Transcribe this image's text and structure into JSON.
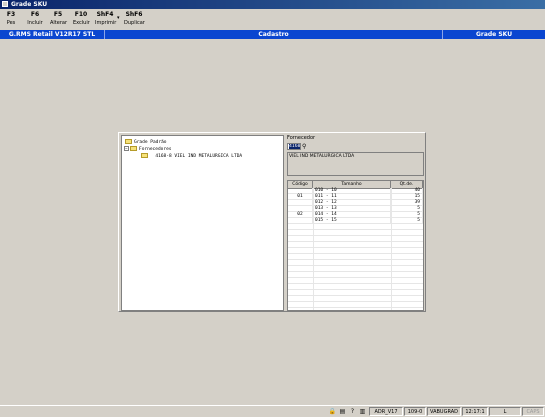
{
  "window": {
    "title": "Grade SKU"
  },
  "toolbar": [
    {
      "key": "F3",
      "label": "Pes"
    },
    {
      "key": "F6",
      "label": "Incluir"
    },
    {
      "key": "F5",
      "label": "Alterar"
    },
    {
      "key": "F10",
      "label": "Excluir"
    },
    {
      "key": "ShF4",
      "label": "Imprimir"
    },
    {
      "key": "ShF6",
      "label": "Duplicar"
    }
  ],
  "toolbar_dropdown": "▾",
  "header": {
    "system": "G.RMS Retail V12R17 STL",
    "section": "Cadastro",
    "module": "Grade SKU",
    "color": "#0a46d0"
  },
  "tree": {
    "root": "Grade Padrão",
    "group": "Fornecedores",
    "group_expander": "−",
    "item": "4168-8 VIEL IND METALURGICA LTDA"
  },
  "fornecedor": {
    "label": "Fornecedor",
    "code": "4168",
    "description": "VIEL IND METALURGICA LTDA"
  },
  "grid": {
    "headers": [
      "Código",
      "Tamanho",
      "Qt.de."
    ],
    "rows": [
      {
        "codigo": "",
        "tamanho": "010 - 10",
        "qtde": "40"
      },
      {
        "codigo": "01",
        "tamanho": "011 - 11",
        "qtde": "15"
      },
      {
        "codigo": "",
        "tamanho": "012 - 12",
        "qtde": "39"
      },
      {
        "codigo": "",
        "tamanho": "013 - 13",
        "qtde": "5"
      },
      {
        "codigo": "02",
        "tamanho": "014 - 14",
        "qtde": "5"
      },
      {
        "codigo": "",
        "tamanho": "015 - 15",
        "qtde": "5"
      }
    ]
  },
  "status": {
    "user": "ADR_V17",
    "code": "109-0",
    "location": "VABUGRAD",
    "time": "12:17:1",
    "mode": "L",
    "caps": "CAPS"
  }
}
